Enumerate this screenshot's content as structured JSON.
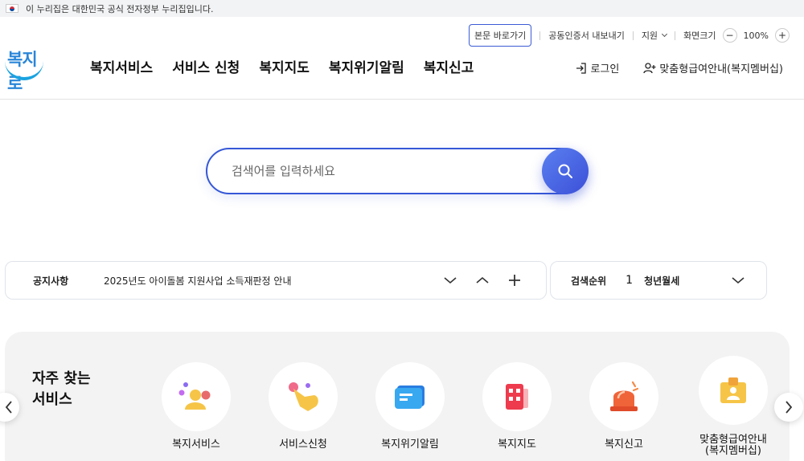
{
  "gov_banner": {
    "text": "이 누리집은 대한민국 공식 전자정부 누리집입니다."
  },
  "utility": {
    "skip_to_content": "본문 바로가기",
    "certificate_export": "공동인증서 내보내기",
    "support": "지원",
    "screen_size_label": "화면크기",
    "zoom_out": "−",
    "zoom_value": "100%",
    "zoom_in": "+"
  },
  "logo": {
    "text": "복지로"
  },
  "nav": {
    "items": [
      "복지서비스",
      "서비스 신청",
      "복지지도",
      "복지위기알림",
      "복지신고"
    ]
  },
  "header_right": {
    "login": "로그인",
    "membership": "맞춤형급여안내(복지멤버십)"
  },
  "search": {
    "placeholder": "검색어를 입력하세요"
  },
  "notice": {
    "label": "공지사항",
    "text": "2025년도 아이돌봄 지원사업 소득재판정 안내"
  },
  "ranking": {
    "label": "검색순위",
    "rank": "1",
    "term": "청년월세"
  },
  "quick_services": {
    "title_line1": "자주 찾는",
    "title_line2": "서비스",
    "items": [
      {
        "label": "복지서비스",
        "icon": "people-icon"
      },
      {
        "label": "서비스신청",
        "icon": "hand-click-icon"
      },
      {
        "label": "복지위기알림",
        "icon": "message-icon"
      },
      {
        "label": "복지지도",
        "icon": "map-building-icon"
      },
      {
        "label": "복지신고",
        "icon": "siren-icon"
      },
      {
        "label_line1": "맞춤형급여안내",
        "label_line2": "(복지멤버십)",
        "icon": "id-card-icon"
      }
    ]
  },
  "colors": {
    "primary": "#3557d6",
    "banner_bg": "#f2f3f5",
    "quick_bg": "#f3f3f3"
  }
}
